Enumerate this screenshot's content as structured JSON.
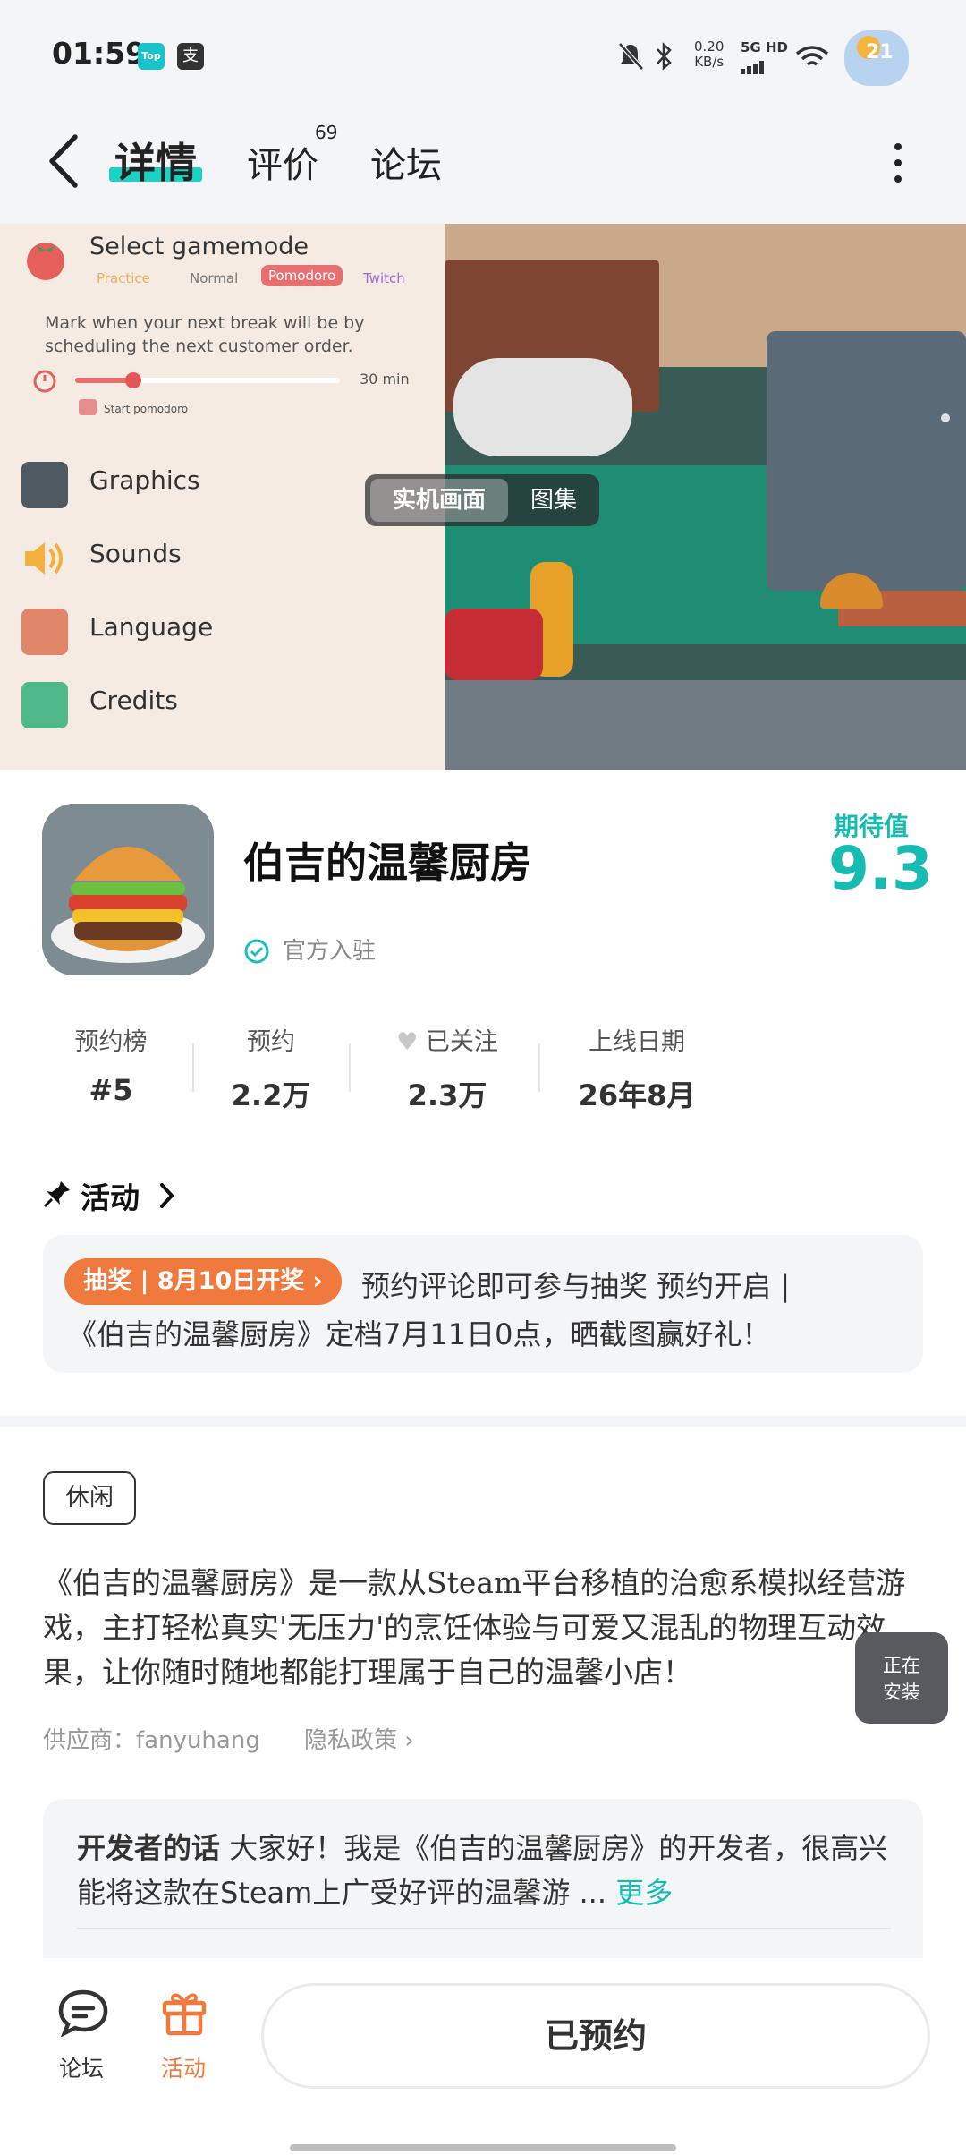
{
  "status_bar": {
    "time": "01:59",
    "app_badge_1": "Top",
    "app_badge_2": "支",
    "net_speed_value": "0.20",
    "net_speed_unit": "KB/s",
    "network": "5G HD",
    "battery_level": "21"
  },
  "nav": {
    "tabs": [
      {
        "label": "详情",
        "active": true
      },
      {
        "label": "评价",
        "badge": "69"
      },
      {
        "label": "论坛"
      }
    ]
  },
  "hero": {
    "game_menu": {
      "title": "Select gamemode",
      "modes": [
        "Practice",
        "Normal",
        "Pomodoro",
        "Twitch"
      ],
      "selected_mode": "Pomodoro",
      "note": "Mark when your next break will be by scheduling the next customer order.",
      "slider_value_label": "30 min",
      "slider_level": 0.22,
      "start_label": "Start pomodoro",
      "items": [
        "Graphics",
        "Sounds",
        "Language",
        "Credits"
      ]
    },
    "media_switch": {
      "active": "实机画面",
      "inactive": "图集"
    }
  },
  "game": {
    "title": "伯吉的温馨厨房",
    "verified": "官方入驻",
    "expect_label": "期待值",
    "expect_value": "9.3"
  },
  "stats": [
    {
      "label": "预约榜",
      "value": "#5"
    },
    {
      "label": "预约",
      "value": "2.2万"
    },
    {
      "label": "已关注",
      "value": "2.3万"
    },
    {
      "label": "上线日期",
      "value": "26年8月"
    }
  ],
  "activity": {
    "section_title": "活动",
    "tag": "抽奖 | 8月10日开奖",
    "text_line1": "预约评论即可参与抽奖 预约开启 |",
    "text_line2": "《伯吉的温馨厨房》定档7月11日0点，晒截图赢好礼！"
  },
  "description": {
    "tag": "休闲",
    "text": "《伯吉的温馨厨房》是一款从Steam平台移植的治愈系模拟经营游戏，主打轻松真实'无压力'的烹饪体验与可爱又混乱的物理互动效果，让你随时随地都能打理属于自己的温馨小店！",
    "supplier": "供应商：fanyuhang",
    "privacy": "隐私政策"
  },
  "installing": {
    "line1": "正在",
    "line2": "安装"
  },
  "developer": {
    "label": "开发者的话",
    "text": "大家好！我是《伯吉的温馨厨房》的开发者，很高兴能将这款在Steam上广受好评的温馨游 ...",
    "more": "更多"
  },
  "bottom": {
    "forum_label": "论坛",
    "activity_label": "活动",
    "reserve_button": "已预约"
  },
  "colors": {
    "accent": "#16bcb2",
    "orange": "#f07a3e",
    "background_gray": "#f4f5f7"
  }
}
